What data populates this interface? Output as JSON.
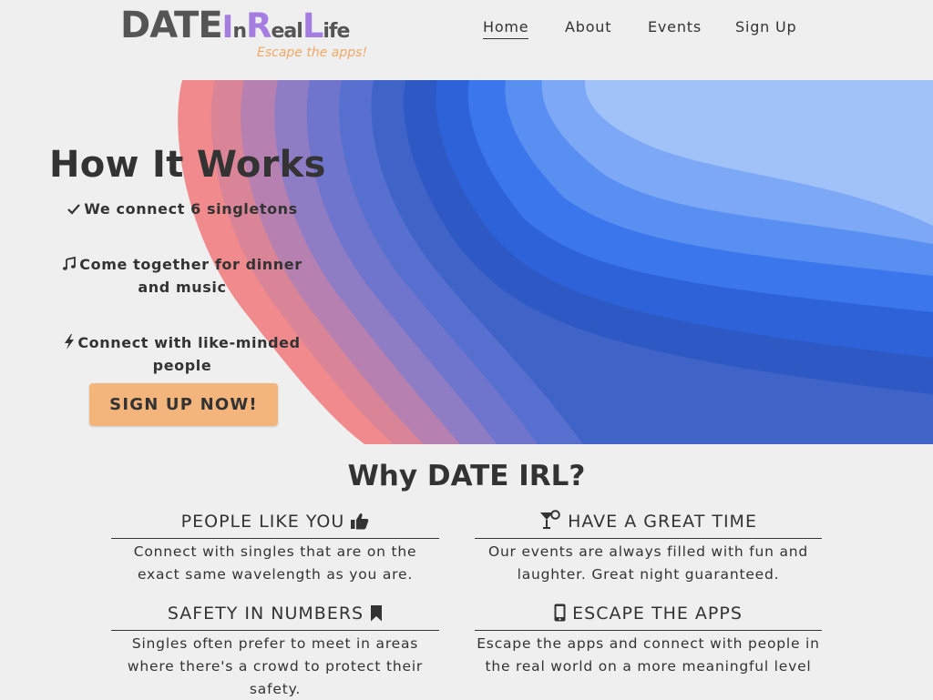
{
  "brand": {
    "logo_parts": [
      "DATE",
      "I",
      "n",
      "R",
      "eal",
      "L",
      "ife"
    ],
    "tagline": "Escape the apps!",
    "accent_purple": "#a57ce0",
    "accent_orange": "#f0a866"
  },
  "nav": {
    "items": [
      {
        "label": "Home",
        "active": true
      },
      {
        "label": "About"
      },
      {
        "label": "Events"
      },
      {
        "label": "Sign Up"
      }
    ]
  },
  "hero": {
    "title": "How It Works",
    "features": [
      {
        "icon": "checkmark-icon",
        "text": "We connect 6 singletons"
      },
      {
        "icon": "music-note-icon",
        "text": "Come together for dinner and music"
      },
      {
        "icon": "lightning-bolt-icon",
        "text": "Connect with like-minded people"
      }
    ],
    "cta_label": "SIGN UP NOW!",
    "cta_color": "#f3b57c"
  },
  "why": {
    "title": "Why DATE IRL?",
    "cards": [
      {
        "heading": "PEOPLE LIKE YOU",
        "icon": "thumbs-up-icon",
        "body": "Connect with singles that are on the exact same wavelength as you are."
      },
      {
        "heading": "HAVE A GREAT TIME",
        "icon": "cocktail-glass-icon",
        "body": "Our events are always filled with fun and laughter. Great night guaranteed."
      },
      {
        "heading": "SAFETY IN NUMBERS",
        "icon": "bookmark-icon",
        "body": "Singles often prefer to meet in areas where there's a crowd to protect their safety."
      },
      {
        "heading": "ESCAPE THE APPS",
        "icon": "mobile-phone-icon",
        "body": "Escape the apps and connect with people in the real world on a more meaningful level"
      }
    ]
  }
}
